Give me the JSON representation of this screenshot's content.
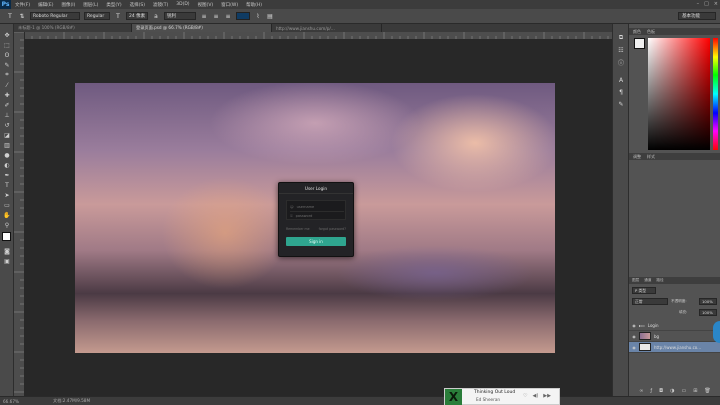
{
  "app": {
    "logo": "Ps"
  },
  "menu": [
    "文件(F)",
    "编辑(E)",
    "图像(I)",
    "图层(L)",
    "类型(Y)",
    "选择(S)",
    "滤镜(T)",
    "3D(D)",
    "视图(V)",
    "窗口(W)",
    "帮助(H)"
  ],
  "window_controls": [
    "–",
    "□",
    "×"
  ],
  "options": {
    "font_family": "Roboto Regular",
    "font_style": "Regular",
    "font_size": "24 像素",
    "anti_alias": "锐利",
    "color": "#0f3b63",
    "workspace": "基本功能"
  },
  "tabs": [
    {
      "label": "未标题-1 @ 100% (RGB/8#)",
      "active": false
    },
    {
      "label": "登录页面.psd @ 66.7% (RGB/8#)",
      "active": true
    },
    {
      "label": "http://www.jianshu.com/p/...",
      "active": false
    }
  ],
  "tools": [
    "move-tool",
    "marquee-tool",
    "lasso-tool",
    "quick-select-tool",
    "crop-tool",
    "eyedropper-tool",
    "healing-tool",
    "brush-tool",
    "stamp-tool",
    "history-brush-tool",
    "eraser-tool",
    "gradient-tool",
    "blur-tool",
    "dodge-tool",
    "pen-tool",
    "type-tool",
    "path-select-tool",
    "shape-tool",
    "hand-tool",
    "zoom-tool"
  ],
  "login_dialog": {
    "title": "User Login",
    "username_placeholder": "username",
    "password_placeholder": "password",
    "remember": "Remember me",
    "forgot": "forgot password?",
    "button": "Sign in"
  },
  "status": {
    "zoom": "66.67%",
    "doc": "文档:2.47M/9.58M"
  },
  "panels": {
    "color_tabs": [
      "颜色",
      "色板"
    ],
    "adjust_tabs": [
      "调整",
      "样式"
    ],
    "layer_tabs": [
      "图层",
      "通道",
      "路径"
    ],
    "blend_mode": "正常",
    "opacity_label": "不透明度:",
    "opacity": "100%",
    "fill_label": "填充:",
    "fill": "100%",
    "kind": "P 类型"
  },
  "layers": [
    {
      "name": "Login",
      "type": "folder"
    },
    {
      "name": "bg",
      "type": "image"
    },
    {
      "name": "http://www.jianshu.co...",
      "type": "image",
      "selected": true
    }
  ],
  "player": {
    "title": "Thinking Out Loud",
    "artist": "Ed Sheeran",
    "controls": [
      "♡",
      "◀)",
      "▶▶"
    ]
  }
}
